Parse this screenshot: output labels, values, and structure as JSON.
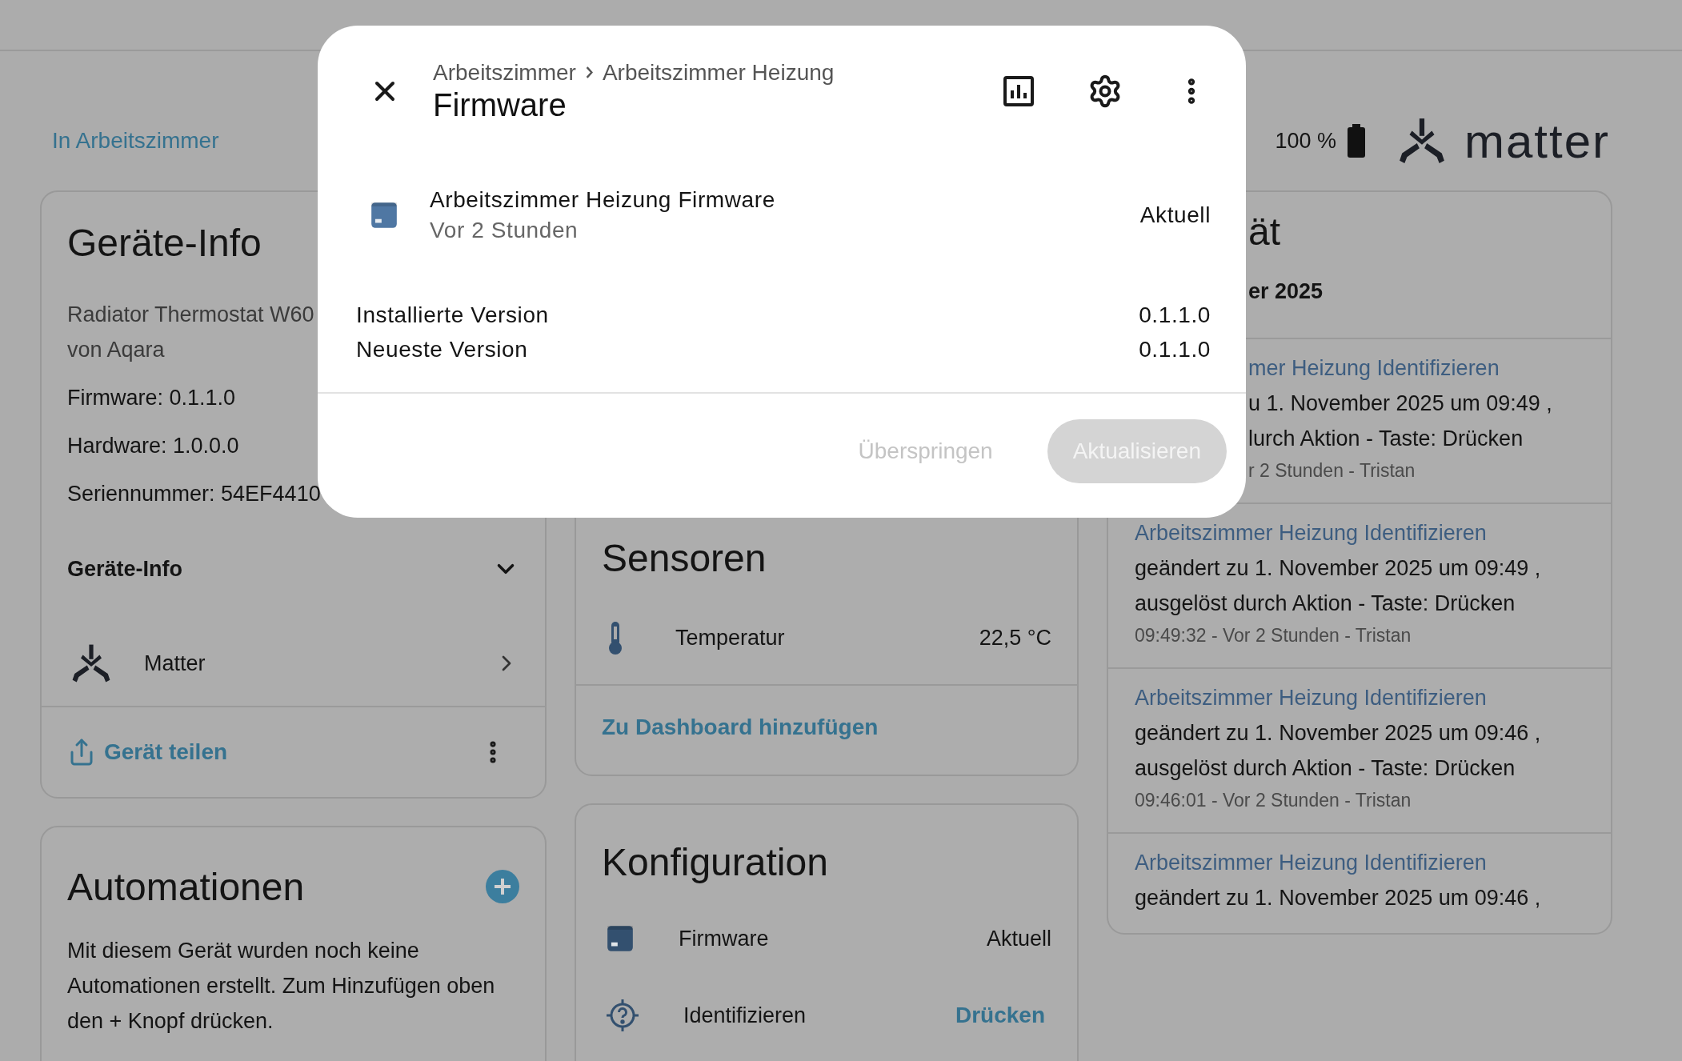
{
  "header": {
    "area_link": "In Arbeitszimmer",
    "battery": "100 %",
    "integration_logo": "matter"
  },
  "device_info": {
    "title": "Geräte-Info",
    "model": "Radiator Thermostat W60",
    "manufacturer": "von Aqara",
    "lines": [
      "Firmware: 0.1.1.0",
      "Hardware: 1.0.0.0",
      "Seriennummer: 54EF4410"
    ],
    "section": {
      "label": "Geräte-Info",
      "expanded": false
    },
    "integration": "Matter",
    "share": "Gerät teilen"
  },
  "automations": {
    "title": "Automationen",
    "text": "Mit diesem Gerät wurden noch keine Automationen erstellt. Zum Hinzufügen oben den + Knopf drücken."
  },
  "sensors": {
    "title": "Sensoren",
    "items": [
      {
        "label": "Temperatur",
        "value": "22,5 °C"
      }
    ],
    "add_button": "Zu Dashboard hinzufügen"
  },
  "configuration": {
    "title": "Konfiguration",
    "items": [
      {
        "kind": "state",
        "label": "Firmware",
        "value": "Aktuell"
      },
      {
        "kind": "button",
        "label": "Identifizieren",
        "value": "Drücken"
      }
    ]
  },
  "activity": {
    "title": "ät",
    "date": "er 2025",
    "entries": [
      {
        "kind": "clipped",
        "name": "mer Heizung Identifizieren",
        "lines": [
          "u 1. November 2025 um 09:49 ,",
          "lurch Aktion - Taste: Drücken"
        ],
        "meta": "r 2 Stunden - Tristan"
      },
      {
        "kind": "full",
        "name": "Arbeitszimmer Heizung Identifizieren",
        "lines": [
          "geändert zu 1. November 2025 um 09:49 ,",
          "ausgelöst durch Aktion - Taste: Drücken"
        ],
        "meta": "09:49:32 - Vor 2 Stunden - Tristan"
      },
      {
        "kind": "full",
        "name": "Arbeitszimmer Heizung Identifizieren",
        "lines": [
          "geändert zu 1. November 2025 um 09:46 ,",
          "ausgelöst durch Aktion - Taste: Drücken"
        ],
        "meta": "09:46:01 - Vor 2 Stunden - Tristan"
      },
      {
        "kind": "full",
        "name": "Arbeitszimmer Heizung Identifizieren",
        "lines": [
          "geändert zu 1. November 2025 um 09:46 ,"
        ]
      }
    ]
  },
  "dialog": {
    "breadcrumb": [
      "Arbeitszimmer",
      "Arbeitszimmer Heizung"
    ],
    "title": "Firmware",
    "entity": {
      "name": "Arbeitszimmer Heizung Firmware",
      "updated": "Vor 2 Stunden",
      "state": "Aktuell"
    },
    "versions": [
      {
        "label": "Installierte Version",
        "value": "0.1.1.0"
      },
      {
        "label": "Neueste Version",
        "value": "0.1.1.0"
      }
    ],
    "buttons": [
      {
        "kind": "text",
        "label": "Überspringen",
        "disabled": true
      },
      {
        "kind": "filled",
        "label": "Aktualisieren",
        "disabled": true
      }
    ]
  }
}
